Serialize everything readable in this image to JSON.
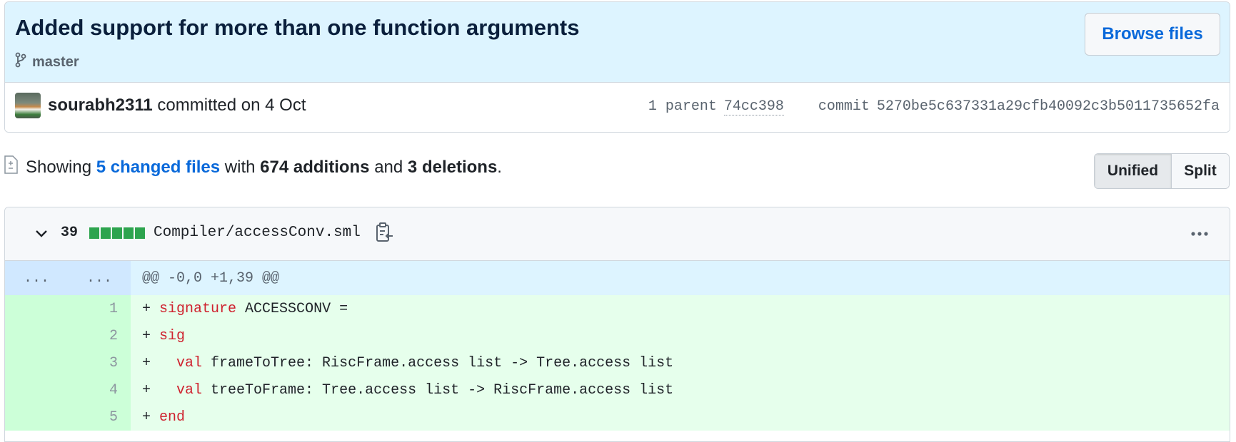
{
  "commit": {
    "title": "Added support for more than one function arguments",
    "branch": "master",
    "browse_label": "Browse files",
    "author": "sourabh2311",
    "committed_text": "committed on 4 Oct",
    "parent_label": "1 parent",
    "parent_sha": "74cc398",
    "commit_label": "commit",
    "commit_sha": "5270be5c637331a29cfb40092c3b5011735652fa"
  },
  "summary": {
    "prefix": "Showing",
    "changed_files": "5 changed files",
    "with": "with",
    "additions": "674 additions",
    "and": "and",
    "deletions": "3 deletions",
    "suffix": "."
  },
  "view_toggle": {
    "unified": "Unified",
    "split": "Split",
    "selected": "Unified"
  },
  "file": {
    "change_count": "39",
    "path": "Compiler/accessConv.sml",
    "diffstat_color": "#2da44e",
    "hunk": {
      "old_ellipsis": "...",
      "new_ellipsis": "...",
      "header": "@@ -0,0 +1,39 @@"
    },
    "lines": [
      {
        "num": "1",
        "prefix": "+ ",
        "indent": "",
        "kw": "signature",
        "rest": " ACCESSCONV ="
      },
      {
        "num": "2",
        "prefix": "+ ",
        "indent": "",
        "kw": "sig",
        "rest": ""
      },
      {
        "num": "3",
        "prefix": "+ ",
        "indent": "  ",
        "kw": "val",
        "rest": " frameToTree: RiscFrame.access list -> Tree.access list"
      },
      {
        "num": "4",
        "prefix": "+ ",
        "indent": "  ",
        "kw": "val",
        "rest": " treeToFrame: Tree.access list -> RiscFrame.access list"
      },
      {
        "num": "5",
        "prefix": "+ ",
        "indent": "",
        "kw": "end",
        "rest": ""
      }
    ]
  },
  "colors": {
    "header_bg": "#ddf4ff",
    "link": "#0969da",
    "added_bg": "#e6ffec",
    "added_num_bg": "#ccffd8",
    "keyword": "#cf222e"
  }
}
